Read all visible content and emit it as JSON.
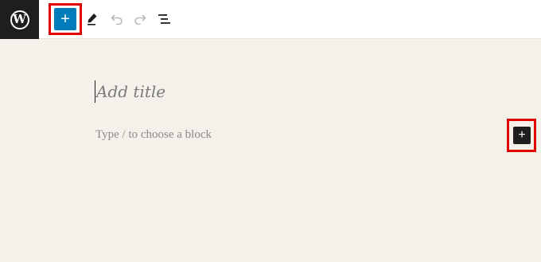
{
  "toolbar": {
    "logo_icon": "wordpress-logo-icon",
    "inserter_symbol": "+",
    "inserter_color": "#007cba",
    "tools": [
      {
        "name": "edit",
        "icon": "pencil-icon"
      },
      {
        "name": "undo",
        "icon": "undo-icon"
      },
      {
        "name": "redo",
        "icon": "redo-icon"
      },
      {
        "name": "list-view",
        "icon": "list-view-icon"
      }
    ],
    "highlight_color": "#e00000"
  },
  "editor": {
    "title_placeholder": "Add title",
    "block_placeholder": "Type / to choose a block",
    "side_inserter_symbol": "+",
    "background_color": "#f4f1ea"
  }
}
